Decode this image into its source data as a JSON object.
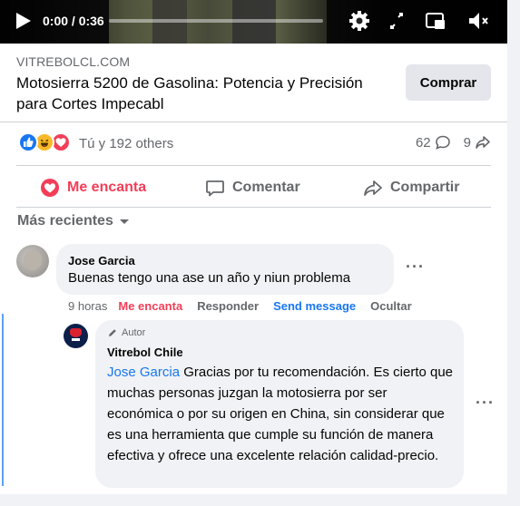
{
  "video": {
    "time": "0:00 / 0:36",
    "progress_fraction": 0.0,
    "controls": [
      "play-icon",
      "settings-icon",
      "fullscreen-icon",
      "miniplayer-icon",
      "muted-icon"
    ]
  },
  "ad": {
    "sponsor_domain": "VITREBOLCL.COM",
    "title": "Motosierra 5200 de Gasolina: Potencia y Precisión para Cortes Impecabl",
    "cta_label": "Comprar"
  },
  "stats": {
    "reaction_icons": [
      "like-icon",
      "haha-icon",
      "love-icon"
    ],
    "reactions_text": "Tú y 192 others",
    "comments_count": "62",
    "shares_count": "9"
  },
  "actions": {
    "love_label": "Me encanta",
    "comment_label": "Comentar",
    "share_label": "Compartir"
  },
  "comments_sort": {
    "label": "Más recientes"
  },
  "comment1": {
    "author": "Jose Garcia",
    "text": "Buenas tengo una ase un año y niun problema",
    "time": "9 horas",
    "reaction_label": "Me encanta",
    "reply_label": "Responder",
    "message_label": "Send message",
    "hide_label": "Ocultar"
  },
  "reply1": {
    "badge": "Autor",
    "author": "Vitrebol Chile",
    "mention": "Jose Garcia",
    "text": " Gracias por tu recomendación. Es cierto que muchas personas juzgan la motosierra por ser económica o por su origen en China, sin considerar que es una herramienta que cumple su función de manera efectiva y ofrece una excelente relación calidad-precio."
  },
  "colors": {
    "accent_blue": "#1877f2",
    "love_red": "#f33e58",
    "secondary_text": "#65676b",
    "bubble_bg": "#f0f2f5"
  }
}
